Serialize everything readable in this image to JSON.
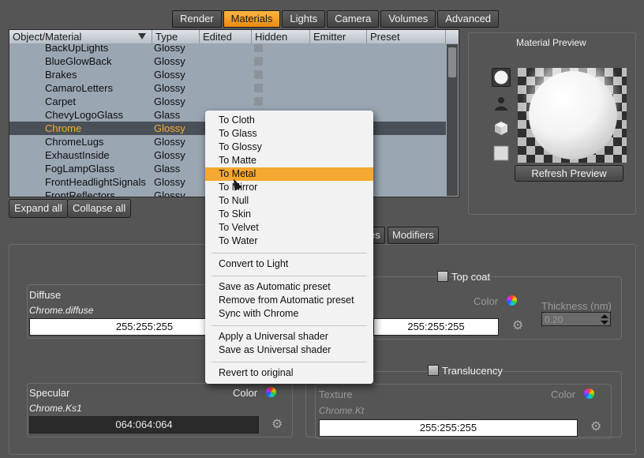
{
  "tabs": [
    {
      "label": "Render",
      "active": false
    },
    {
      "label": "Materials",
      "active": true
    },
    {
      "label": "Lights",
      "active": false
    },
    {
      "label": "Camera",
      "active": false
    },
    {
      "label": "Volumes",
      "active": false
    },
    {
      "label": "Advanced",
      "active": false
    }
  ],
  "table": {
    "columns": [
      "Object/Material",
      "Type",
      "Edited",
      "Hidden",
      "Emitter",
      "Preset"
    ],
    "rows": [
      {
        "name": "BackUpLights",
        "type": "Glossy"
      },
      {
        "name": "BlueGlowBack",
        "type": "Glossy"
      },
      {
        "name": "Brakes",
        "type": "Glossy"
      },
      {
        "name": "CamaroLetters",
        "type": "Glossy"
      },
      {
        "name": "Carpet",
        "type": "Glossy"
      },
      {
        "name": "ChevyLogoGlass",
        "type": "Glass"
      },
      {
        "name": "Chrome",
        "type": "Glossy",
        "selected": true
      },
      {
        "name": "ChromeLugs",
        "type": "Glossy"
      },
      {
        "name": "ExhaustInside",
        "type": "Glossy"
      },
      {
        "name": "FogLampGlass",
        "type": "Glass"
      },
      {
        "name": "FrontHeadlightSignals",
        "type": "Glossy"
      },
      {
        "name": "FrontReflectors",
        "type": "Glossy"
      }
    ],
    "expand_all": "Expand all",
    "collapse_all": "Collapse all"
  },
  "preview": {
    "title": "Material Preview",
    "refresh": "Refresh Preview",
    "shape_icons": [
      "sphere-icon",
      "figure-icon",
      "cube-icon",
      "plane-icon"
    ]
  },
  "subtabs": {
    "partial": "es",
    "modifiers": "Modifiers"
  },
  "diffuse": {
    "title": "Diffuse",
    "param": "Chrome.diffuse",
    "value": "255:255:255"
  },
  "topcoat": {
    "label": "Top coat",
    "color_label": "Color",
    "value": "255:255:255",
    "thickness_label": "Thickness (nm)",
    "thickness_value": "0.20"
  },
  "specular": {
    "title": "Specular",
    "color_label": "Color",
    "param": "Chrome.Ks1",
    "value": "064:064:064"
  },
  "translucency": {
    "label": "Translucency",
    "texture_label": "Texture",
    "color_label": "Color",
    "param": "Chrome.Kt",
    "value": "255:255:255"
  },
  "menu": {
    "group1": [
      "To Cloth",
      "To Glass",
      "To Glossy",
      "To Matte",
      "To Metal",
      "To Mirror",
      "To Null",
      "To Skin",
      "To Velvet",
      "To Water"
    ],
    "highlighted": "To Metal",
    "group2": [
      "Convert to Light"
    ],
    "group3": [
      "Save as Automatic preset",
      "Remove from Automatic preset",
      "Sync with Chrome"
    ],
    "group4": [
      "Apply a Universal shader",
      "Save as Universal shader"
    ],
    "group5": [
      "Revert to original"
    ]
  },
  "colors": {
    "accent": "#f5a832",
    "selection_row": "#4a5058",
    "table_bg": "#9aa6b2",
    "background": "#555555"
  }
}
